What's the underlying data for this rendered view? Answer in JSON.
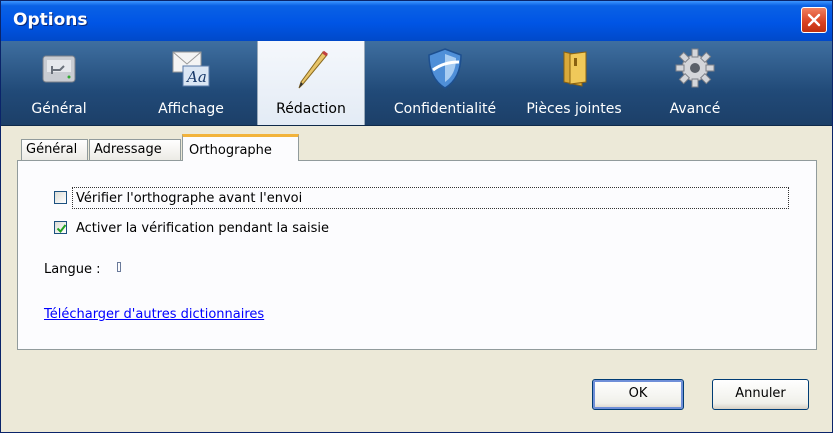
{
  "window": {
    "title": "Options"
  },
  "panes": [
    {
      "label": "Général",
      "icon": "drive-icon",
      "selected": false
    },
    {
      "label": "Affichage",
      "icon": "display-font-icon",
      "selected": false
    },
    {
      "label": "Rédaction",
      "icon": "pencil-icon",
      "selected": true
    },
    {
      "label": "Confidentialité",
      "icon": "shield-icon",
      "selected": false
    },
    {
      "label": "Pièces jointes",
      "icon": "folder-icon",
      "selected": false
    },
    {
      "label": "Avancé",
      "icon": "gear-icon",
      "selected": false
    }
  ],
  "tabs": [
    {
      "label": "Général",
      "active": false
    },
    {
      "label": "Adressage",
      "active": false
    },
    {
      "label": "Orthographe",
      "active": true
    }
  ],
  "orthographe": {
    "check_before_send": {
      "label": "Vérifier l'orthographe avant l'envoi",
      "checked": false
    },
    "check_while_typing": {
      "label": "Activer la vérification pendant la saisie",
      "checked": true
    },
    "language_label": "Langue :",
    "language_value": "",
    "download_link": "Télécharger d'autres dictionnaires"
  },
  "buttons": {
    "ok": "OK",
    "cancel": "Annuler"
  },
  "colors": {
    "titlebar": "#0055e5",
    "toolbar": "#214a78",
    "tab_accent": "#f2b33b",
    "link": "#0000ff"
  }
}
